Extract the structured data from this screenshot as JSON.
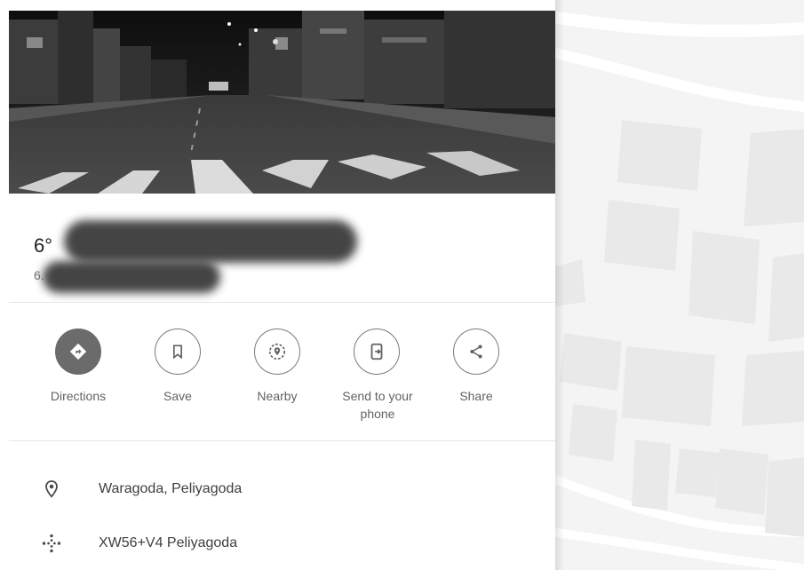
{
  "place": {
    "title": "6°",
    "subtitle": "6."
  },
  "actions": [
    {
      "label": "Directions",
      "icon": "directions-icon"
    },
    {
      "label": "Save",
      "icon": "bookmark-icon"
    },
    {
      "label": "Nearby",
      "icon": "nearby-icon"
    },
    {
      "label": "Send to your phone",
      "icon": "send-to-phone-icon"
    },
    {
      "label": "Share",
      "icon": "share-icon"
    }
  ],
  "details": {
    "address": "Waragoda, Peliyagoda",
    "plus_code": "XW56+V4 Peliyagoda"
  },
  "colors": {
    "accent": "#6b6b6b",
    "icon": "#5f6368",
    "map_bg": "#f4f4f4",
    "map_building": "#e9e9e9"
  }
}
